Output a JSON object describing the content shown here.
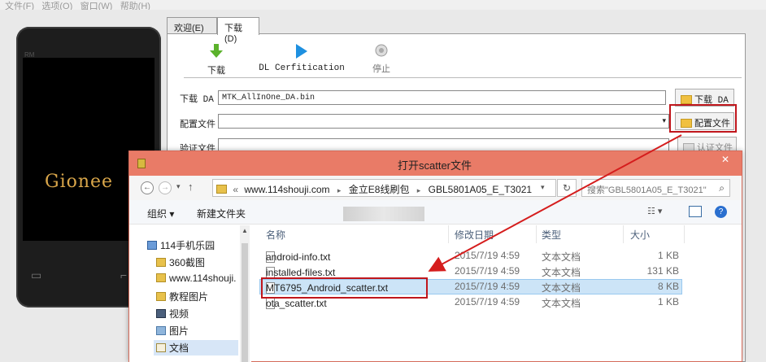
{
  "menubar": {
    "items": [
      "文件(F)",
      "选项(O)",
      "窗口(W)",
      "帮助(H)"
    ]
  },
  "phone": {
    "logo": "Gionee",
    "brand": "RM"
  },
  "tabs": [
    {
      "label": "欢迎(E)"
    },
    {
      "label": "下载(D)"
    }
  ],
  "toolbar": {
    "download_label": "下载",
    "certify_label": "DL Cerfitication",
    "stop_label": "停止"
  },
  "form": {
    "da_label": "下载 DA",
    "da_value": "MTK_AllInOne_DA.bin",
    "da_button": "下载 DA",
    "config_label": "配置文件",
    "config_value": "",
    "config_button": "配置文件",
    "verify_label": "验证文件",
    "verify_button": "认证文件"
  },
  "dialog": {
    "title": "打开scatter文件",
    "breadcrumb": [
      "«",
      "www.114shouji.com",
      "金立E8线刷包",
      "GBL5801A05_E_T3021"
    ],
    "search_placeholder": "搜索\"GBL5801A05_E_T3021\"",
    "organize_label": "组织 ▾",
    "new_folder_label": "新建文件夹",
    "nav_items": [
      {
        "label": "114手机乐园",
        "icon": "computer-icon"
      },
      {
        "label": "360截图",
        "icon": "folder-icon"
      },
      {
        "label": "www.114shouji.",
        "icon": "folder-icon"
      },
      {
        "label": "教程图片",
        "icon": "folder-icon"
      },
      {
        "label": "视频",
        "icon": "video-icon"
      },
      {
        "label": "图片",
        "icon": "picture-icon"
      },
      {
        "label": "文档",
        "icon": "document-icon"
      }
    ],
    "columns": {
      "name": "名称",
      "date": "修改日期",
      "type": "类型",
      "size": "大小"
    },
    "files": [
      {
        "name": "android-info.txt",
        "date": "2015/7/19 4:59",
        "type": "文本文档",
        "size": "1 KB"
      },
      {
        "name": "installed-files.txt",
        "date": "2015/7/19 4:59",
        "type": "文本文档",
        "size": "131 KB"
      },
      {
        "name": "MT6795_Android_scatter.txt",
        "date": "2015/7/19 4:59",
        "type": "文本文档",
        "size": "8 KB"
      },
      {
        "name": "ota_scatter.txt",
        "date": "2015/7/19 4:59",
        "type": "文本文档",
        "size": "1 KB"
      }
    ],
    "selected_file_index": 2
  },
  "colors": {
    "title_bar": "#e97b67",
    "highlight_box": "#c0161c",
    "selection": "#cce4f7"
  }
}
